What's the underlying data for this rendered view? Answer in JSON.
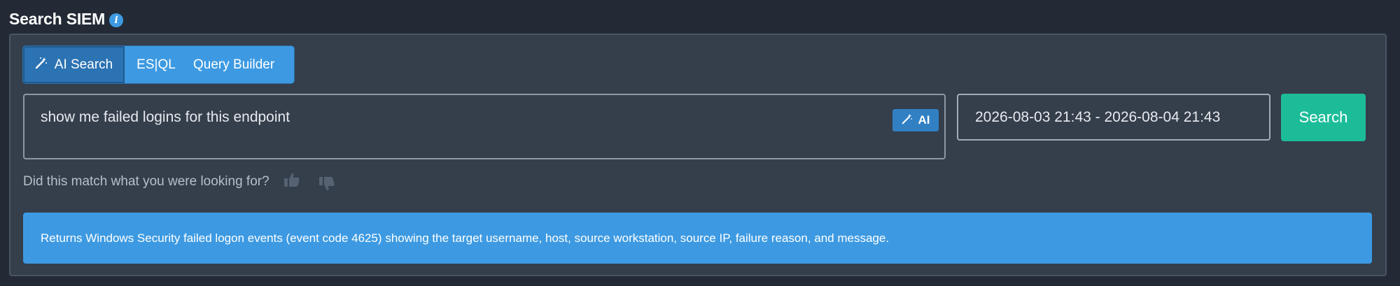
{
  "header": {
    "title": "Search SIEM",
    "info_icon": "i"
  },
  "tabs": [
    {
      "label": "AI Search",
      "icon": "magic-wand-icon",
      "active": true
    },
    {
      "label": "ES|QL",
      "active": false
    },
    {
      "label": "Query Builder",
      "active": false
    }
  ],
  "query": {
    "value": "show me failed logins for this endpoint",
    "ai_badge": "AI"
  },
  "date_range": {
    "value": "2026-08-03 21:43 - 2026-08-04 21:43"
  },
  "search_button": {
    "label": "Search"
  },
  "feedback": {
    "prompt": "Did this match what you were looking for?",
    "thumbs_up_icon": "thumbs-up-icon",
    "thumbs_down_icon": "thumbs-down-icon"
  },
  "description": {
    "text": "Returns Windows Security failed logon events (event code 4625) showing the target username, host, source workstation, source IP, failure reason, and message."
  },
  "colors": {
    "page_bg": "#232a36",
    "panel_bg": "#353e4b",
    "accent_blue": "#3d9ae2",
    "active_tab": "#2c73b3",
    "search_green": "#1dbc99"
  }
}
